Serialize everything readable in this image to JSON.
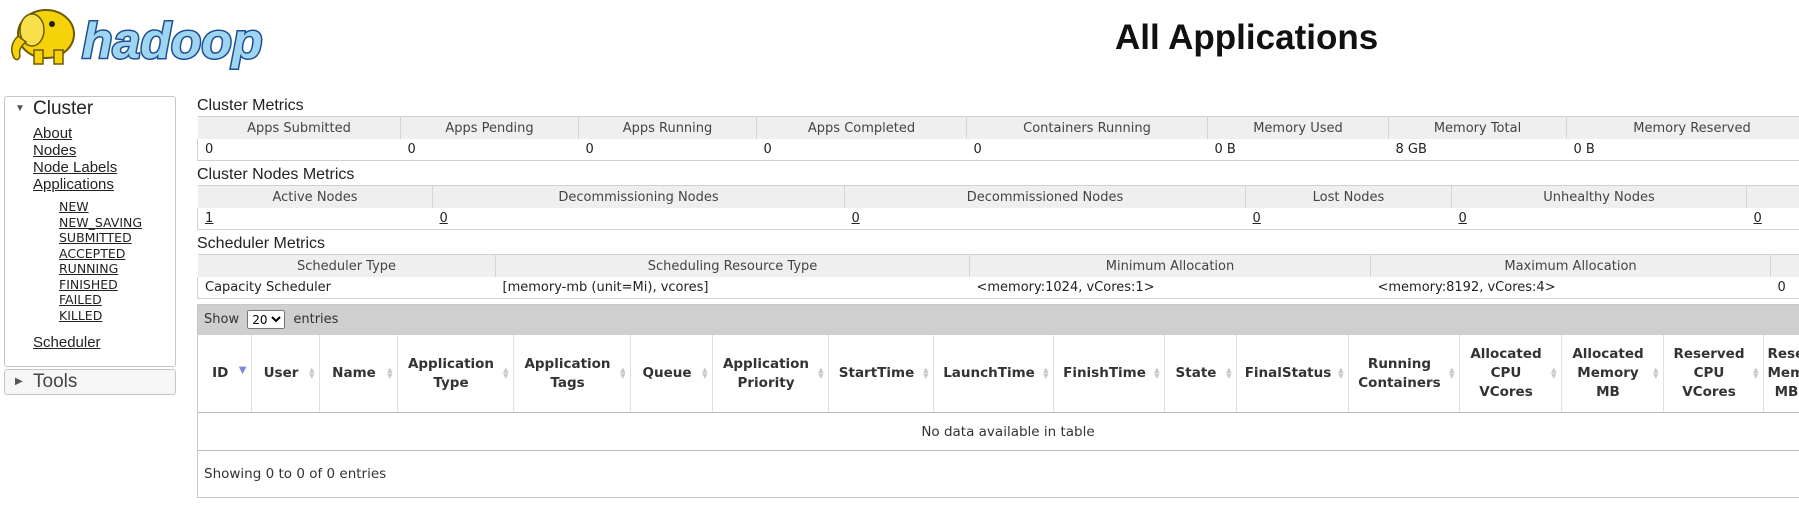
{
  "logo": {
    "text": "hadoop"
  },
  "page": {
    "title": "All Applications"
  },
  "sidebar": {
    "cluster_label": "Cluster",
    "tools_label": "Tools",
    "main_links": [
      "About",
      "Nodes",
      "Node Labels",
      "Applications"
    ],
    "app_states": [
      "NEW",
      "NEW_SAVING",
      "SUBMITTED",
      "ACCEPTED",
      "RUNNING",
      "FINISHED",
      "FAILED",
      "KILLED"
    ],
    "scheduler_link": "Scheduler"
  },
  "cluster_metrics": {
    "title": "Cluster Metrics",
    "headers": [
      "Apps Submitted",
      "Apps Pending",
      "Apps Running",
      "Apps Completed",
      "Containers Running",
      "Memory Used",
      "Memory Total",
      "Memory Reserved"
    ],
    "values": [
      "0",
      "0",
      "0",
      "0",
      "0",
      "0 B",
      "8 GB",
      "0 B"
    ]
  },
  "nodes_metrics": {
    "title": "Cluster Nodes Metrics",
    "headers": [
      "Active Nodes",
      "Decommissioning Nodes",
      "Decommissioned Nodes",
      "Lost Nodes",
      "Unhealthy Nodes",
      ""
    ],
    "values": [
      "1",
      "0",
      "0",
      "0",
      "0",
      "0"
    ]
  },
  "scheduler_metrics": {
    "title": "Scheduler Metrics",
    "headers": [
      "Scheduler Type",
      "Scheduling Resource Type",
      "Minimum Allocation",
      "Maximum Allocation",
      ""
    ],
    "values": [
      "Capacity Scheduler",
      "[memory-mb (unit=Mi), vcores]",
      "<memory:1024, vCores:1>",
      "<memory:8192, vCores:4>",
      "0"
    ]
  },
  "apps_table": {
    "show_label": "Show",
    "entries_label": "entries",
    "page_size": "20",
    "columns": [
      "ID",
      "User",
      "Name",
      "Application Type",
      "Application Tags",
      "Queue",
      "Application Priority",
      "StartTime",
      "LaunchTime",
      "FinishTime",
      "State",
      "FinalStatus",
      "Running Containers",
      "Allocated CPU VCores",
      "Allocated Memory MB",
      "Reserved CPU VCores",
      "Reserved Memory MB"
    ],
    "empty_message": "No data available in table",
    "info": "Showing 0 to 0 of 0 entries"
  },
  "colors": {
    "sort_active": "#7f8bd6",
    "header_bg": "#efefef",
    "toolbar_bg": "#cfcfcf",
    "logo_blue": "#1d4f91",
    "elephant_yellow": "#f5d20a"
  }
}
